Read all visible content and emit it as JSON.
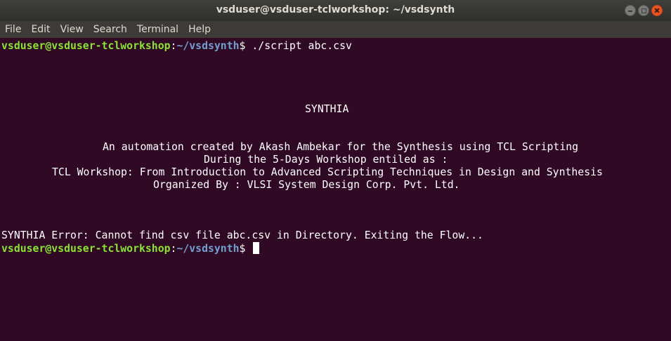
{
  "window": {
    "title": "vsduser@vsduser-tclworkshop: ~/vsdsynth"
  },
  "menu": {
    "items": [
      "File",
      "Edit",
      "View",
      "Search",
      "Terminal",
      "Help"
    ]
  },
  "prompt": {
    "user_host": "vsduser@vsduser-tclworkshop",
    "colon": ":",
    "path": "~/vsdsynth",
    "symbol": "$ "
  },
  "terminal": {
    "command": "./script abc.csv",
    "banner": {
      "title": "SYNTHIA",
      "line1": "An automation created by Akash Ambekar for the Synthesis using TCL Scripting",
      "line2": "During the 5-Days Workshop entiled as :",
      "line3": "TCL Workshop: From Introduction to Advanced Scripting Techniques in Design and Synthesis",
      "line4": "Organized By : VLSI System Design Corp. Pvt. Ltd."
    },
    "error": "SYNTHIA Error: Cannot find csv file abc.csv in Directory. Exiting the Flow..."
  },
  "colors": {
    "terminal_bg": "#300a24",
    "prompt_user": "#8ae234",
    "prompt_path": "#729fcf",
    "close_button": "#e95420"
  }
}
